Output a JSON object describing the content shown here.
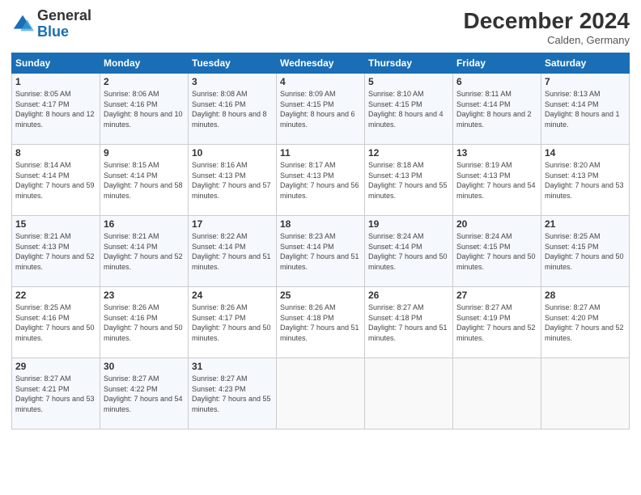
{
  "logo": {
    "general": "General",
    "blue": "Blue"
  },
  "header": {
    "month": "December 2024",
    "location": "Calden, Germany"
  },
  "days": [
    "Sunday",
    "Monday",
    "Tuesday",
    "Wednesday",
    "Thursday",
    "Friday",
    "Saturday"
  ],
  "weeks": [
    [
      {
        "day": "1",
        "sunrise": "8:05 AM",
        "sunset": "4:17 PM",
        "daylight": "8 hours and 12 minutes."
      },
      {
        "day": "2",
        "sunrise": "8:06 AM",
        "sunset": "4:16 PM",
        "daylight": "8 hours and 10 minutes."
      },
      {
        "day": "3",
        "sunrise": "8:08 AM",
        "sunset": "4:16 PM",
        "daylight": "8 hours and 8 minutes."
      },
      {
        "day": "4",
        "sunrise": "8:09 AM",
        "sunset": "4:15 PM",
        "daylight": "8 hours and 6 minutes."
      },
      {
        "day": "5",
        "sunrise": "8:10 AM",
        "sunset": "4:15 PM",
        "daylight": "8 hours and 4 minutes."
      },
      {
        "day": "6",
        "sunrise": "8:11 AM",
        "sunset": "4:14 PM",
        "daylight": "8 hours and 2 minutes."
      },
      {
        "day": "7",
        "sunrise": "8:13 AM",
        "sunset": "4:14 PM",
        "daylight": "8 hours and 1 minute."
      }
    ],
    [
      {
        "day": "8",
        "sunrise": "8:14 AM",
        "sunset": "4:14 PM",
        "daylight": "7 hours and 59 minutes."
      },
      {
        "day": "9",
        "sunrise": "8:15 AM",
        "sunset": "4:14 PM",
        "daylight": "7 hours and 58 minutes."
      },
      {
        "day": "10",
        "sunrise": "8:16 AM",
        "sunset": "4:13 PM",
        "daylight": "7 hours and 57 minutes."
      },
      {
        "day": "11",
        "sunrise": "8:17 AM",
        "sunset": "4:13 PM",
        "daylight": "7 hours and 56 minutes."
      },
      {
        "day": "12",
        "sunrise": "8:18 AM",
        "sunset": "4:13 PM",
        "daylight": "7 hours and 55 minutes."
      },
      {
        "day": "13",
        "sunrise": "8:19 AM",
        "sunset": "4:13 PM",
        "daylight": "7 hours and 54 minutes."
      },
      {
        "day": "14",
        "sunrise": "8:20 AM",
        "sunset": "4:13 PM",
        "daylight": "7 hours and 53 minutes."
      }
    ],
    [
      {
        "day": "15",
        "sunrise": "8:21 AM",
        "sunset": "4:13 PM",
        "daylight": "7 hours and 52 minutes."
      },
      {
        "day": "16",
        "sunrise": "8:21 AM",
        "sunset": "4:14 PM",
        "daylight": "7 hours and 52 minutes."
      },
      {
        "day": "17",
        "sunrise": "8:22 AM",
        "sunset": "4:14 PM",
        "daylight": "7 hours and 51 minutes."
      },
      {
        "day": "18",
        "sunrise": "8:23 AM",
        "sunset": "4:14 PM",
        "daylight": "7 hours and 51 minutes."
      },
      {
        "day": "19",
        "sunrise": "8:24 AM",
        "sunset": "4:14 PM",
        "daylight": "7 hours and 50 minutes."
      },
      {
        "day": "20",
        "sunrise": "8:24 AM",
        "sunset": "4:15 PM",
        "daylight": "7 hours and 50 minutes."
      },
      {
        "day": "21",
        "sunrise": "8:25 AM",
        "sunset": "4:15 PM",
        "daylight": "7 hours and 50 minutes."
      }
    ],
    [
      {
        "day": "22",
        "sunrise": "8:25 AM",
        "sunset": "4:16 PM",
        "daylight": "7 hours and 50 minutes."
      },
      {
        "day": "23",
        "sunrise": "8:26 AM",
        "sunset": "4:16 PM",
        "daylight": "7 hours and 50 minutes."
      },
      {
        "day": "24",
        "sunrise": "8:26 AM",
        "sunset": "4:17 PM",
        "daylight": "7 hours and 50 minutes."
      },
      {
        "day": "25",
        "sunrise": "8:26 AM",
        "sunset": "4:18 PM",
        "daylight": "7 hours and 51 minutes."
      },
      {
        "day": "26",
        "sunrise": "8:27 AM",
        "sunset": "4:18 PM",
        "daylight": "7 hours and 51 minutes."
      },
      {
        "day": "27",
        "sunrise": "8:27 AM",
        "sunset": "4:19 PM",
        "daylight": "7 hours and 52 minutes."
      },
      {
        "day": "28",
        "sunrise": "8:27 AM",
        "sunset": "4:20 PM",
        "daylight": "7 hours and 52 minutes."
      }
    ],
    [
      {
        "day": "29",
        "sunrise": "8:27 AM",
        "sunset": "4:21 PM",
        "daylight": "7 hours and 53 minutes."
      },
      {
        "day": "30",
        "sunrise": "8:27 AM",
        "sunset": "4:22 PM",
        "daylight": "7 hours and 54 minutes."
      },
      {
        "day": "31",
        "sunrise": "8:27 AM",
        "sunset": "4:23 PM",
        "daylight": "7 hours and 55 minutes."
      },
      null,
      null,
      null,
      null
    ]
  ]
}
